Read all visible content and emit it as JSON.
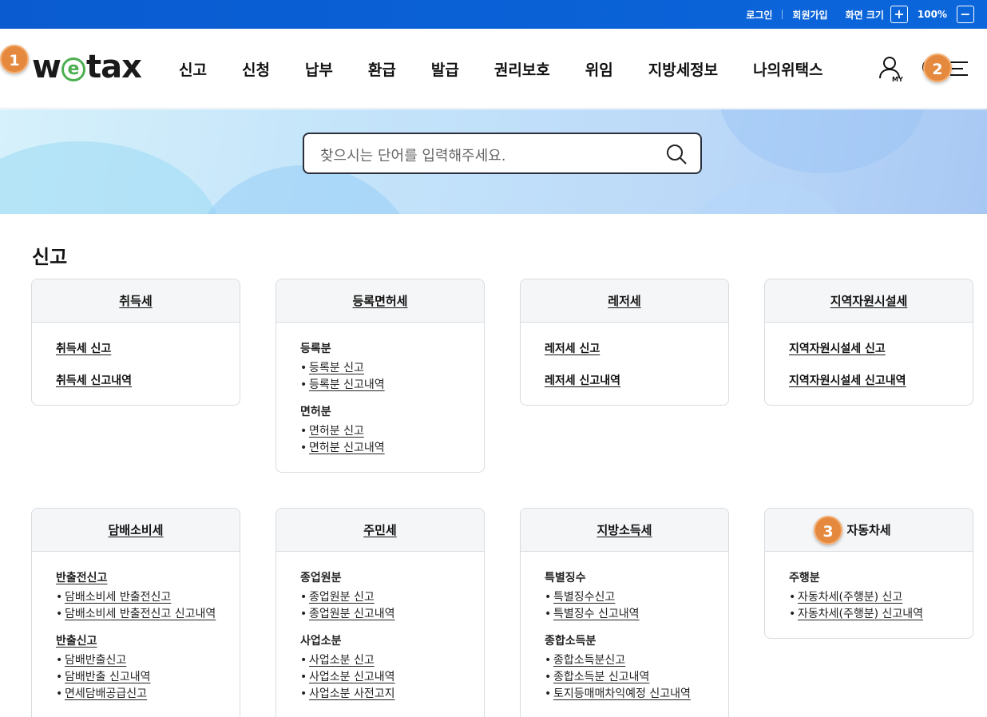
{
  "topbar": {
    "login": "로그인",
    "signup": "회원가입",
    "zoom_label": "화면 크기",
    "zoom_in": "+",
    "zoom_value": "100%",
    "zoom_out": "−"
  },
  "header": {
    "logo_w": "w",
    "logo_e": "e",
    "logo_tax": "tax",
    "my_label": "MY",
    "nav": [
      "신고",
      "신청",
      "납부",
      "환급",
      "발급",
      "권리보호",
      "위임",
      "지방세정보",
      "나의위택스"
    ],
    "icons": [
      "my-page-icon",
      "search-icon",
      "menu-icon"
    ]
  },
  "search": {
    "placeholder": "찾으시는 단어를 입력해주세요."
  },
  "markers": [
    "1",
    "2",
    "3"
  ],
  "section": {
    "title": "신고",
    "cards": [
      {
        "title": "취득세",
        "links": [
          "취득세 신고",
          "취득세 신고내역"
        ]
      },
      {
        "title": "등록면허세",
        "groups": [
          {
            "label": "등록분",
            "items": [
              "등록분 신고",
              "등록분 신고내역"
            ]
          },
          {
            "label": "면허분",
            "items": [
              "면허분 신고",
              "면허분 신고내역"
            ]
          }
        ]
      },
      {
        "title": "레저세",
        "links": [
          "레저세 신고",
          "레저세 신고내역"
        ]
      },
      {
        "title": "지역자원시설세",
        "links": [
          "지역자원시설세 신고",
          "지역자원시설세 신고내역"
        ]
      },
      {
        "title": "담배소비세",
        "groups": [
          {
            "label": "반출전신고",
            "items": [
              "담배소비세 반출전신고",
              "담배소비세 반출전신고 신고내역"
            ]
          },
          {
            "label": "반출신고",
            "items": [
              "담배반출신고",
              "담배반출 신고내역",
              "면세담배공급신고"
            ]
          }
        ]
      },
      {
        "title": "주민세",
        "groups": [
          {
            "label": "종업원분",
            "items": [
              "종업원분 신고",
              "종업원분 신고내역"
            ]
          },
          {
            "label": "사업소분",
            "items": [
              "사업소분 신고",
              "사업소분 신고내역",
              "사업소분 사전고지"
            ]
          }
        ]
      },
      {
        "title": "지방소득세",
        "groups": [
          {
            "label": "특별징수",
            "items": [
              "특별징수신고",
              "특별징수 신고내역"
            ]
          },
          {
            "label": "종합소득분",
            "items": [
              "종합소득분신고",
              "종합소득분 신고내역",
              "토지등매매차익예정 신고내역"
            ]
          }
        ]
      },
      {
        "title": "자동차세",
        "groups": [
          {
            "label": "주행분",
            "items": [
              "자동차세(주행분) 신고",
              "자동차세(주행분) 신고내역"
            ]
          }
        ]
      }
    ]
  }
}
